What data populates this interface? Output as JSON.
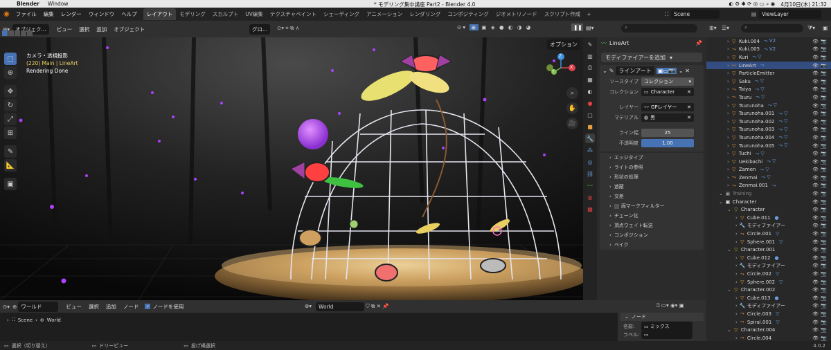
{
  "mac": {
    "app": "Blender",
    "window_menu": "Window",
    "doc_title": "* モデリング集中講座 Part2 - Blender 4.0",
    "date": "4月10日(木) 21:32"
  },
  "menu": [
    "ファイル",
    "編集",
    "レンダー",
    "ウィンドウ",
    "ヘルプ"
  ],
  "workspace_tabs": [
    "レイアウト",
    "モデリング",
    "スカルプト",
    "UV編集",
    "テクスチャペイント",
    "シェーディング",
    "アニメーション",
    "レンダリング",
    "コンポジティング",
    "ジオメトリノード",
    "スクリプト作成"
  ],
  "active_tab": "レイアウト",
  "scene": {
    "scene_name": "Scene",
    "view_layer": "ViewLayer"
  },
  "viewport_header": {
    "mode": "オブジェク...",
    "menus": [
      "ビュー",
      "選択",
      "追加",
      "オブジェクト"
    ],
    "transform": "グロ...",
    "options": "オプション"
  },
  "overlay_text": {
    "title": "カメラ・透視投影",
    "line2": "(220) Main | LineArt",
    "line3": "Rendering Done"
  },
  "gizmo": {
    "x": "X",
    "y": "Y",
    "z": "Z"
  },
  "properties": {
    "object_name": "LineArt",
    "add_modifier": "モディファイアーを追加",
    "modifier_name": "ラインアート",
    "fields": [
      {
        "label": "ソースタイプ",
        "value": "コレクション"
      },
      {
        "label": "コレクション",
        "value": "Character"
      },
      {
        "label": "レイヤー",
        "value": "GPレイヤー"
      },
      {
        "label": "マテリアル",
        "value": "黒"
      },
      {
        "label": "ライン幅",
        "value": "25"
      },
      {
        "label": "不透明度",
        "value": "1.00"
      }
    ],
    "opacity_fraction": 1.0,
    "sections": [
      "エッジタイプ",
      "ライトの参照",
      "形状の処理",
      "遮蔽",
      "交差",
      "面マークフィルター",
      "チェーン化",
      "頂点ウェイト転送",
      "コンポジション",
      "ベイク"
    ]
  },
  "outliner": [
    {
      "name": "Kuki.004",
      "indent": 2,
      "icon": "▽",
      "color": "#e8a03e",
      "extra": "⤳ V2"
    },
    {
      "name": "Kuki.005",
      "indent": 2,
      "icon": "⤳",
      "color": "#e8a03e",
      "extra": "⤳ V2"
    },
    {
      "name": "Kuri",
      "indent": 2,
      "icon": "▽",
      "color": "#e8a03e",
      "extra": "⤳ ▽"
    },
    {
      "name": "LineArt",
      "indent": 2,
      "icon": "〰",
      "color": "#e8a03e",
      "extra": "⤳",
      "selected": true
    },
    {
      "name": "ParticleEmitter",
      "indent": 2,
      "icon": "▽",
      "color": "#e8a03e",
      "extra": ""
    },
    {
      "name": "Saku",
      "indent": 2,
      "icon": "▽",
      "color": "#e8a03e",
      "extra": "⤳ ▽"
    },
    {
      "name": "Taiya",
      "indent": 2,
      "icon": "⤳",
      "color": "#e8a03e",
      "extra": "⤳ ▽"
    },
    {
      "name": "Tsuru",
      "indent": 2,
      "icon": "⤳",
      "color": "#e8a03e",
      "extra": "⤳ ▽"
    },
    {
      "name": "Tsurunoha",
      "indent": 2,
      "icon": "▽",
      "color": "#e8a03e",
      "extra": "⤳ ▽"
    },
    {
      "name": "Tsurunoha.001",
      "indent": 2,
      "icon": "▽",
      "color": "#e8a03e",
      "extra": "⤳ ▽"
    },
    {
      "name": "Tsurunoha.002",
      "indent": 2,
      "icon": "▽",
      "color": "#e8a03e",
      "extra": "⤳ ▽"
    },
    {
      "name": "Tsurunoha.003",
      "indent": 2,
      "icon": "▽",
      "color": "#e8a03e",
      "extra": "⤳ ▽"
    },
    {
      "name": "Tsurunoha.004",
      "indent": 2,
      "icon": "▽",
      "color": "#e8a03e",
      "extra": "⤳ ▽"
    },
    {
      "name": "Tsurunoha.005",
      "indent": 2,
      "icon": "▽",
      "color": "#e8a03e",
      "extra": "⤳ ▽"
    },
    {
      "name": "Tuchi",
      "indent": 2,
      "icon": "▽",
      "color": "#e8a03e",
      "extra": "⤳ ▽"
    },
    {
      "name": "Uekibachi",
      "indent": 2,
      "icon": "▽",
      "color": "#e8a03e",
      "extra": "⤳ ▽"
    },
    {
      "name": "Zamen",
      "indent": 2,
      "icon": "▽",
      "color": "#e8a03e",
      "extra": "⤳ ▽"
    },
    {
      "name": "Zenmai",
      "indent": 2,
      "icon": "⤳",
      "color": "#e8a03e",
      "extra": "⤳ ▽"
    },
    {
      "name": "Zenmai.001",
      "indent": 2,
      "icon": "⤳",
      "color": "#e8a03e",
      "extra": "⤳"
    },
    {
      "name": "Training",
      "indent": 1,
      "icon": "▣",
      "color": "#999",
      "extra": "",
      "dim": true
    },
    {
      "name": "Character",
      "indent": 1,
      "icon": "▣",
      "color": "#e8e8e8",
      "extra": ""
    },
    {
      "name": "Character",
      "indent": 2,
      "icon": "▽",
      "color": "#e8a03e",
      "extra": ""
    },
    {
      "name": "Cube.011",
      "indent": 3,
      "icon": "▽",
      "color": "#e8a03e",
      "extra": "●"
    },
    {
      "name": "モディファイアー",
      "indent": 3,
      "icon": "🔧",
      "color": "#6aa0e0",
      "extra": ""
    },
    {
      "name": "Circle.001",
      "indent": 3,
      "icon": "⤳",
      "color": "#e8a03e",
      "extra": "▽"
    },
    {
      "name": "Sphere.001",
      "indent": 3,
      "icon": "▽",
      "color": "#e8a03e",
      "extra": "▽"
    },
    {
      "name": "Character.001",
      "indent": 2,
      "icon": "▽",
      "color": "#e8a03e",
      "extra": ""
    },
    {
      "name": "Cube.012",
      "indent": 3,
      "icon": "▽",
      "color": "#e8a03e",
      "extra": "●"
    },
    {
      "name": "モディファイアー",
      "indent": 3,
      "icon": "🔧",
      "color": "#6aa0e0",
      "extra": ""
    },
    {
      "name": "Circle.002",
      "indent": 3,
      "icon": "⤳",
      "color": "#e8a03e",
      "extra": "▽"
    },
    {
      "name": "Sphere.002",
      "indent": 3,
      "icon": "▽",
      "color": "#e8a03e",
      "extra": "▽"
    },
    {
      "name": "Character.002",
      "indent": 2,
      "icon": "▽",
      "color": "#e8a03e",
      "extra": ""
    },
    {
      "name": "Cube.013",
      "indent": 3,
      "icon": "▽",
      "color": "#e8a03e",
      "extra": "●"
    },
    {
      "name": "モディファイアー",
      "indent": 3,
      "icon": "🔧",
      "color": "#6aa0e0",
      "extra": ""
    },
    {
      "name": "Circle.003",
      "indent": 3,
      "icon": "⤳",
      "color": "#e8a03e",
      "extra": "▽"
    },
    {
      "name": "Spiral.001",
      "indent": 3,
      "icon": "⤳",
      "color": "#e8a03e",
      "extra": "▽"
    },
    {
      "name": "Character.004",
      "indent": 2,
      "icon": "▽",
      "color": "#e8a03e",
      "extra": ""
    },
    {
      "name": "Circle.004",
      "indent": 3,
      "icon": "⤳",
      "color": "#e8a03e",
      "extra": ""
    }
  ],
  "node_editor": {
    "world_type": "ワールド",
    "menus": [
      "ビュー",
      "選択",
      "追加",
      "ノード"
    ],
    "use_nodes": "ノードを使用",
    "world_name": "World",
    "breadcrumb_scene": "Scene",
    "breadcrumb_world": "World",
    "panel_title": "ノード",
    "name_label": "名前:",
    "name_value": "ミックス",
    "label_label": "ラベル:"
  },
  "statusbar": {
    "left": "選択（切り替え）",
    "mid": "ドリーピュー",
    "right": "投げ縄選択",
    "version": "4.0.2"
  }
}
